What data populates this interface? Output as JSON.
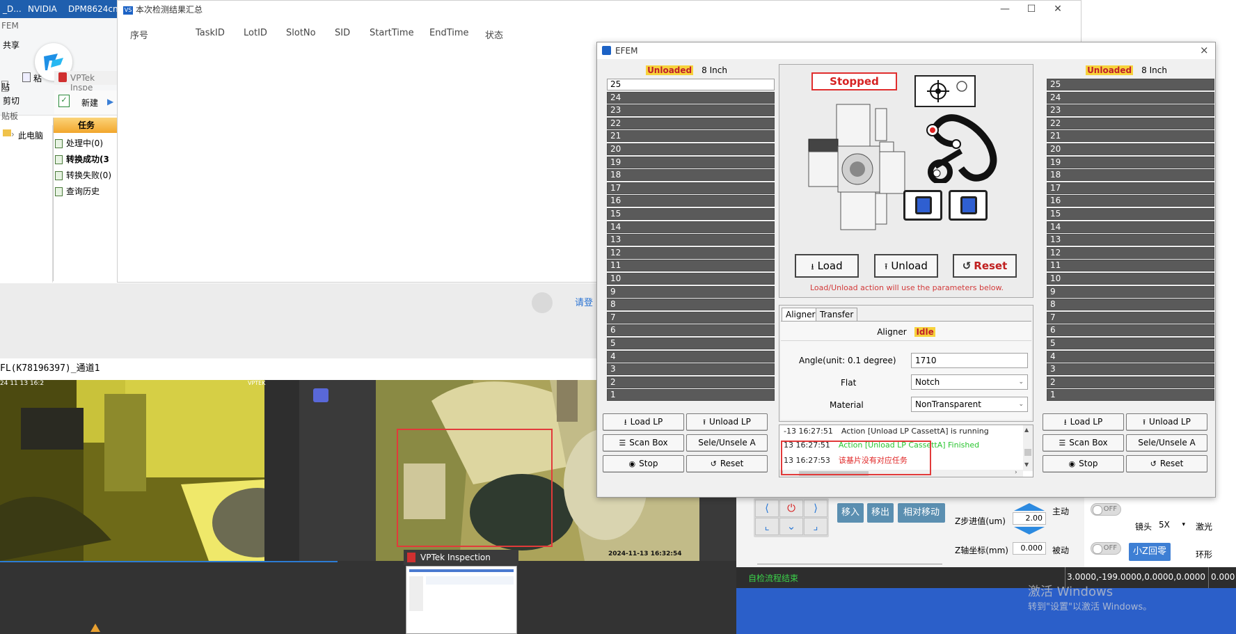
{
  "taskbar": {
    "items": [
      "_D...",
      "NVIDIA",
      "DPM8624cn"
    ]
  },
  "explorer": {
    "top_label": "FEM",
    "share_label": "共享",
    "paste_label": "贴",
    "cut_label": "剪切",
    "clipboard_label": "贴板",
    "pc_label": "此电脑",
    "pc_prefix": "›",
    "app_title": "VPTek Inspe",
    "new_label": "新建",
    "task_header": "任务",
    "task_rows": [
      "处理中(0)",
      "转换成功(3",
      "转换失败(0)",
      "查询历史"
    ],
    "partial_label": "粘"
  },
  "results_window": {
    "title": "本次检测结果汇总",
    "columns": [
      "序号",
      "TaskID",
      "LotID",
      "SlotNo",
      "SID",
      "StartTime",
      "EndTime",
      "状态"
    ],
    "login_text": "请登"
  },
  "channel_label": "FL(K78196397)_通道1",
  "camera": {
    "left_timestamp": "24 11 13 16:2",
    "left_brand": "VPTEK",
    "right_timestamp": "2024-11-13 16:32:54"
  },
  "preview": {
    "title": "VPTek Inspection Syste..."
  },
  "efem": {
    "title": "EFEM",
    "close": "×",
    "left_cassette": {
      "status": "Unloaded",
      "size": "8 Inch",
      "slots": [
        "25",
        "24",
        "23",
        "22",
        "21",
        "20",
        "19",
        "18",
        "17",
        "16",
        "15",
        "14",
        "13",
        "12",
        "11",
        "10",
        "9",
        "8",
        "7",
        "6",
        "5",
        "4",
        "3",
        "2",
        "1"
      ],
      "first_slot_empty": true
    },
    "right_cassette": {
      "status": "Unloaded",
      "size": "8 Inch",
      "slots": [
        "25",
        "24",
        "23",
        "22",
        "21",
        "20",
        "19",
        "18",
        "17",
        "16",
        "15",
        "14",
        "13",
        "12",
        "11",
        "10",
        "9",
        "8",
        "7",
        "6",
        "5",
        "4",
        "3",
        "2",
        "1"
      ]
    },
    "status_label": "Stopped",
    "load_label": "Load",
    "unload_label": "Unload",
    "reset_label": "Reset",
    "hint": "Load/Unload action will use the parameters below.",
    "tabs": [
      "Aligner",
      "Transfer"
    ],
    "aligner": {
      "title": "Aligner",
      "state": "Idle",
      "angle_label": "Angle(unit:  0.1 degree)",
      "angle_value": "1710",
      "flat_label": "Flat",
      "flat_value": "Notch",
      "material_label": "Material",
      "material_value": "NonTransparent"
    },
    "lp_buttons": {
      "load_lp": "Load LP",
      "unload_lp": "Unload LP",
      "scan_box": "Scan Box",
      "sele_unsele": "Sele/Unsele A",
      "stop": "Stop",
      "reset": "Reset"
    },
    "log": [
      {
        "time": "-13 16:27:51",
        "text": "Action [Unload LP CassettA] is running",
        "color": "#222222"
      },
      {
        "time": "13 16:27:51",
        "text": "Action [Unload LP CassettA] Finished",
        "color": "#29c52f"
      },
      {
        "time": "13 16:27:53",
        "text": "该基片没有对应任务",
        "color": "#e02525"
      }
    ]
  },
  "software": {
    "move_in": "移入",
    "move_out": "移出",
    "relative_move": "相对移动",
    "z_step_label": "Z步进值(um)",
    "z_step_value": "2.00",
    "z_coord_label": "Z轴坐标(mm)",
    "z_coord_value": "0.000",
    "active_label": "主动",
    "passive_label": "被动",
    "toggle_off": "OFF",
    "lens_label": "镜头",
    "lens_value": "5X",
    "laser_label": "激光",
    "ring_label": "环形",
    "small_z_zero": "小Z回零",
    "status_left": "自检流程结束",
    "status_coords": "3.0000,-199.0000,0.0000,0.0000",
    "status_coords_tail": "0.000"
  },
  "watermark": {
    "line1": "激活 Windows",
    "line2": "转到\"设置\"以激活 Windows。"
  }
}
